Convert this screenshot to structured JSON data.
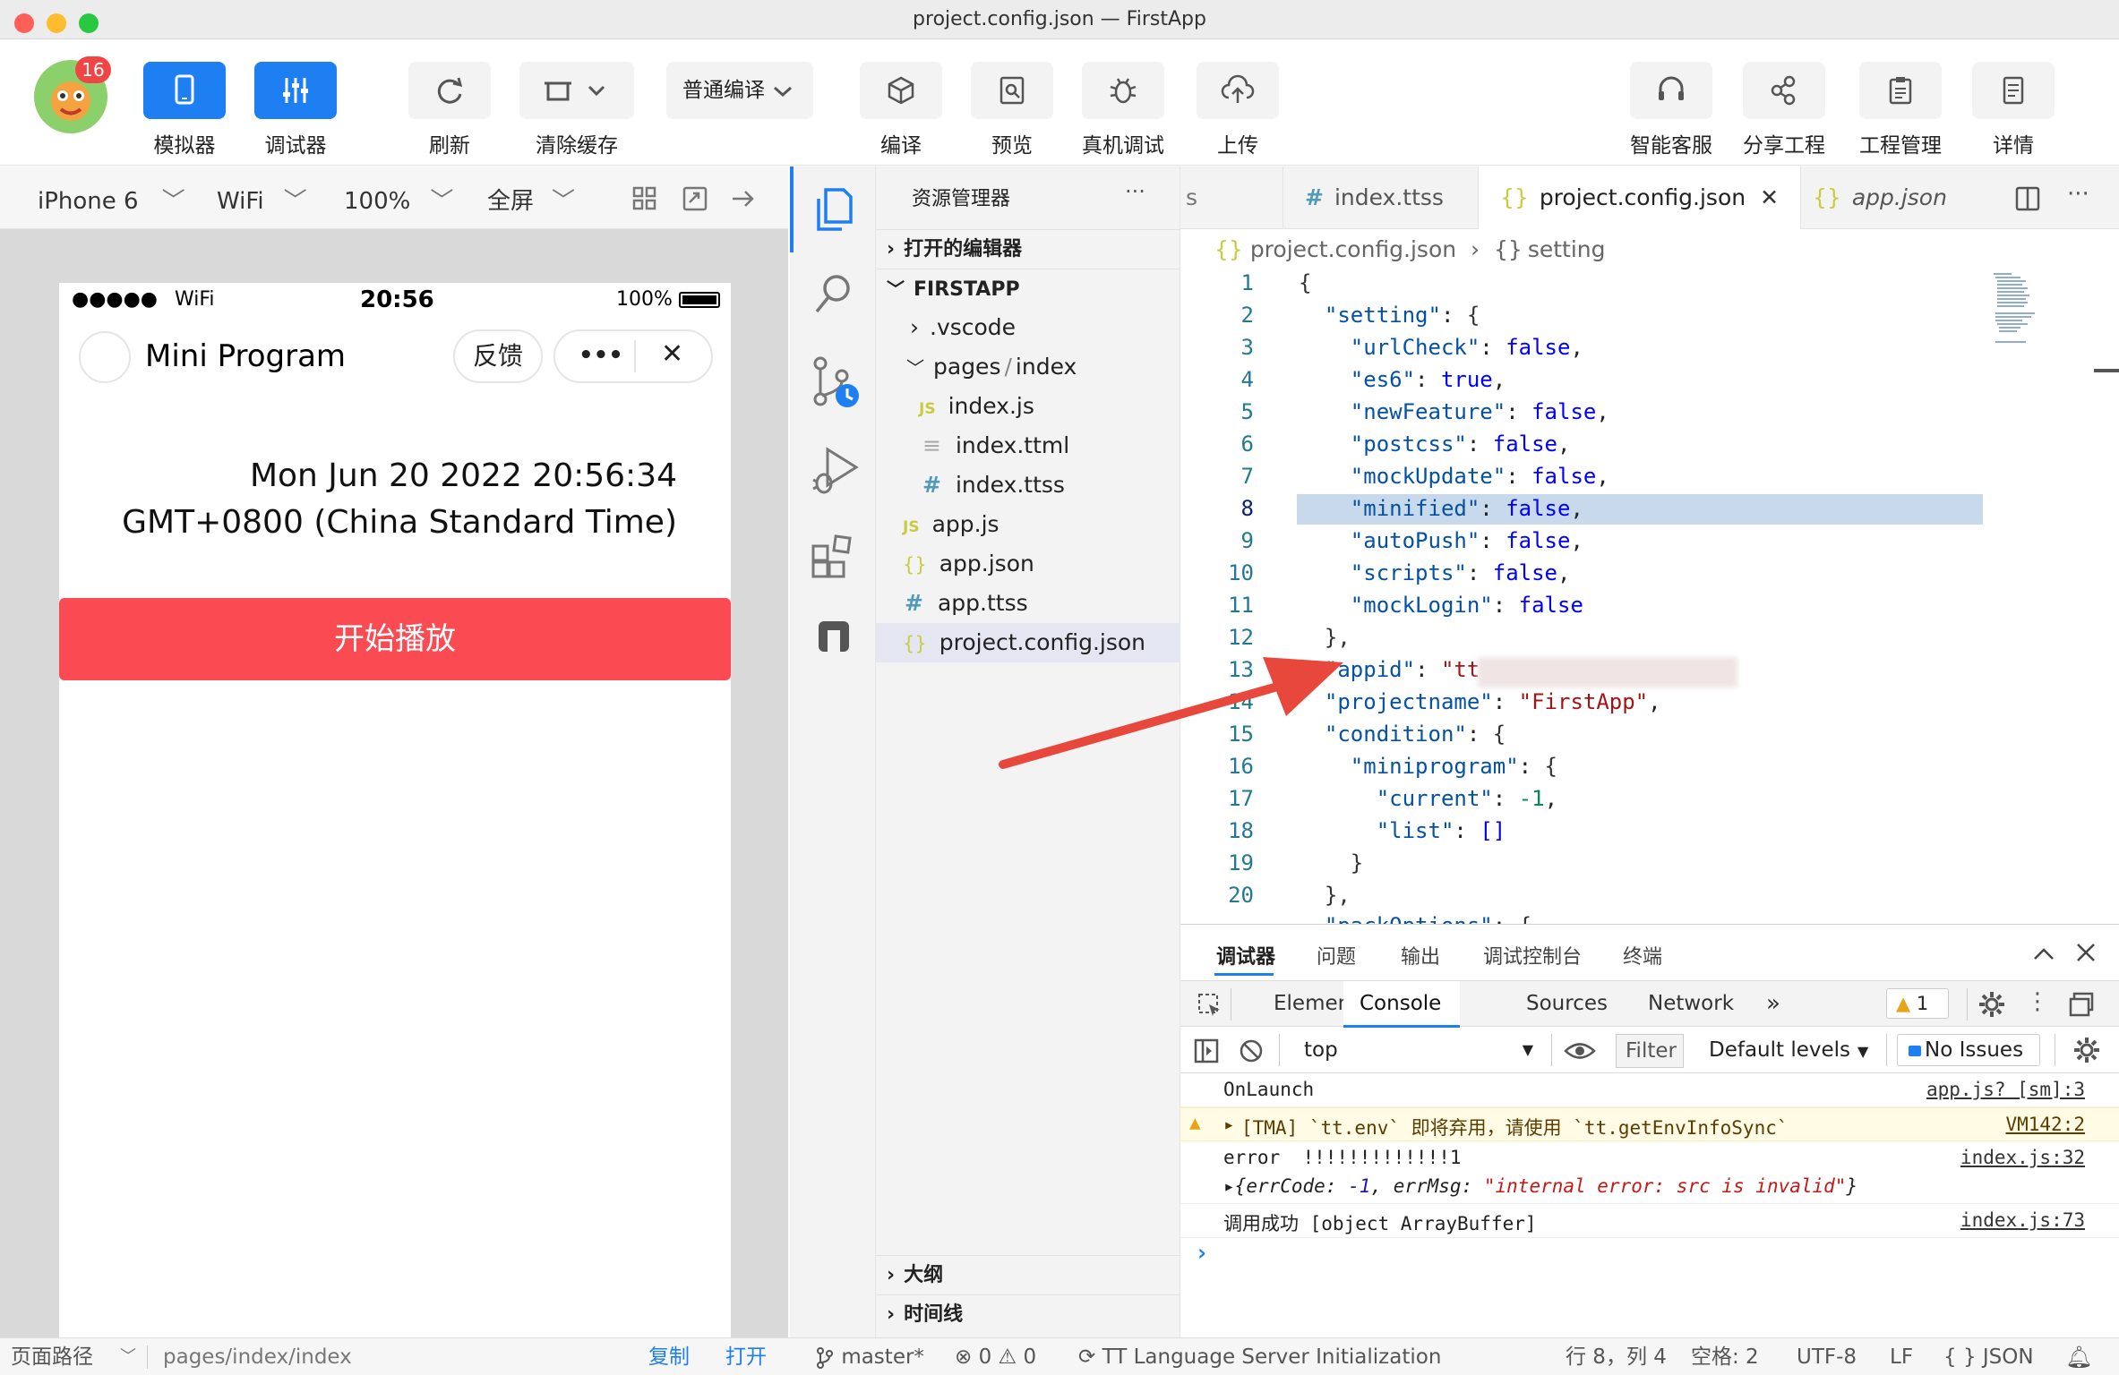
{
  "window": {
    "title": "project.config.json — FirstApp",
    "badge": "16"
  },
  "toolbar": {
    "simulator": "模拟器",
    "debugger": "调试器",
    "refresh": "刷新",
    "clear_cache": "清除缓存",
    "compile_mode": "普通编译",
    "compile": "编译",
    "preview": "预览",
    "device_debug": "真机调试",
    "upload": "上传",
    "support": "智能客服",
    "share": "分享工程",
    "project_mgmt": "工程管理",
    "details": "详情"
  },
  "sim_bar": {
    "device": "iPhone 6",
    "network": "WiFi",
    "zoom": "100%",
    "mode": "全屏"
  },
  "phone": {
    "signal": "●●●●●",
    "wifi": "WiFi",
    "time": "20:56",
    "battery": "100%",
    "title": "Mini Program",
    "feedback": "反馈",
    "more": "•••",
    "close": "✕",
    "date_line1": "Mon Jun 20 2022 20:56:34",
    "date_line2": "GMT+0800 (China Standard Time)",
    "play_button": "开始播放",
    "accent": "#fa4b53"
  },
  "explorer": {
    "title": "资源管理器",
    "more": "···",
    "open_editors": "打开的编辑器",
    "root": "FIRSTAPP",
    "items": [
      {
        "label": ".vscode",
        "icon": ""
      },
      {
        "label": "pages",
        "sep": "/",
        "sub": "index",
        "icon": ""
      },
      {
        "label": "index.js",
        "icon": "JS"
      },
      {
        "label": "index.ttml",
        "icon": "≡"
      },
      {
        "label": "index.ttss",
        "icon": "#"
      },
      {
        "label": "app.js",
        "icon": "JS"
      },
      {
        "label": "app.json",
        "icon": "{}"
      },
      {
        "label": "app.ttss",
        "icon": "#"
      },
      {
        "label": "project.config.json",
        "icon": "{}"
      }
    ],
    "outline": "大纲",
    "timeline": "时间线"
  },
  "editor": {
    "tabs": [
      {
        "label": "s",
        "icon": ""
      },
      {
        "label": "index.ttss",
        "icon": "#"
      },
      {
        "label": "project.config.json",
        "icon": "{}",
        "close": "✕"
      },
      {
        "label": "app.json",
        "icon": "{}"
      }
    ],
    "breadcrumb": {
      "file": "project.config.json",
      "sep": "›",
      "icon": "{}",
      "node": "setting"
    },
    "line_numbers": [
      "1",
      "2",
      "3",
      "4",
      "5",
      "6",
      "7",
      "8",
      "9",
      "10",
      "11",
      "12",
      "13",
      "14",
      "15",
      "16",
      "17",
      "18",
      "19",
      "20"
    ],
    "highlighted_line": 8
  },
  "panel": {
    "tabs": [
      "调试器",
      "问题",
      "输出",
      "调试控制台",
      "终端"
    ],
    "devtools_tabs": [
      "Elements",
      "Console",
      "Sources",
      "Network",
      "»"
    ],
    "warn_count": "1",
    "context": "top",
    "filter": "Filter",
    "levels": "Default levels",
    "issues": "No Issues",
    "logs": {
      "l1": {
        "text": "OnLaunch",
        "src": "app.js? [sm]:3"
      },
      "l2": {
        "text": "[TMA] `tt.env` 即将弃用，请使用 `tt.getEnvInfoSync`",
        "src": "VM142:2"
      },
      "l3": {
        "text": "error  !!!!!!!!!!!!!1",
        "src": "index.js:32"
      },
      "l4": {
        "k1": "errCode",
        "v1": "-1",
        "k2": "errMsg",
        "v2": "\"internal error: src is invalid\""
      },
      "l5": {
        "text": "调用成功 [object ArrayBuffer]",
        "src": "index.js:73"
      }
    },
    "prompt": "›"
  },
  "status": {
    "path_label": "页面路径",
    "path": "pages/index/index",
    "copy": "复制",
    "open": "打开",
    "branch": "master*",
    "errors": "0",
    "warnings": "0",
    "server": "TT Language Server Initialization",
    "position": "行 8，列 4",
    "spaces": "空格: 2",
    "encoding": "UTF-8",
    "eol": "LF",
    "lang": "JSON"
  }
}
